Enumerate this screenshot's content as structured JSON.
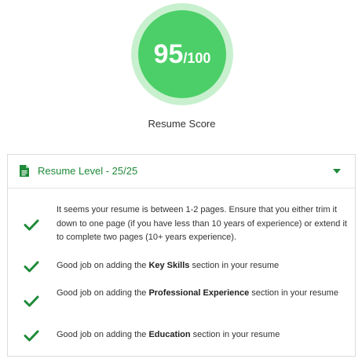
{
  "score": {
    "value": "95",
    "max": "/100",
    "label": "Resume Score"
  },
  "colors": {
    "score_fill": "#4ccf68",
    "score_ring": "#c8f0cf",
    "accent_green": "#1f8a3a"
  },
  "panel": {
    "icon": "document-icon",
    "title": "Resume Level - 25/25",
    "toggle_icon": "caret-down-icon",
    "items": [
      {
        "icon": "check-icon",
        "pre": "It seems your resume is between 1-2 pages. Ensure that you either trim it down to one page (if you have less than 10 years of experience) or extend it to complete two pages (10+ years experience).",
        "bold": "",
        "post": ""
      },
      {
        "icon": "check-icon",
        "pre": "Good job on adding the ",
        "bold": "Key Skills",
        "post": " section in your resume"
      },
      {
        "icon": "check-icon",
        "pre": "Good job on adding the ",
        "bold": "Professional Experience",
        "post": " section in your resume"
      },
      {
        "icon": "check-icon",
        "pre": "Good job on adding the ",
        "bold": "Education",
        "post": " section in your resume"
      }
    ]
  }
}
